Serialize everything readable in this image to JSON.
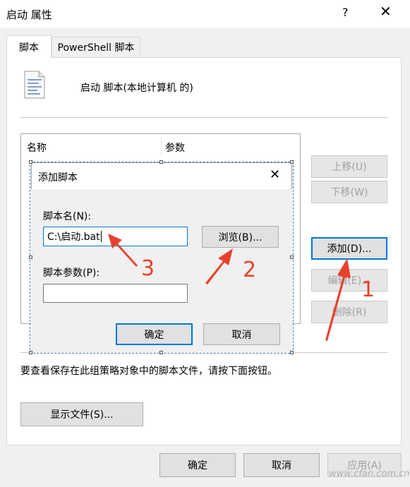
{
  "window": {
    "title": "启动 属性",
    "help_label": "?",
    "close_label": "✕"
  },
  "tabs": [
    {
      "label": "脚本"
    },
    {
      "label": "PowerShell 脚本"
    }
  ],
  "panel": {
    "heading": "启动 脚本(本地计算机 的)",
    "columns": [
      "名称",
      "参数"
    ],
    "buttons": {
      "up": "上移(U)",
      "down": "下移(W)",
      "add": "添加(D)...",
      "edit": "编辑(E)...",
      "remove": "删除(R)"
    },
    "note": "要查看保存在此组策略对象中的脚本文件，请按下面按钮。",
    "show_files": "显示文件(S)..."
  },
  "footer": {
    "ok": "确定",
    "cancel": "取消",
    "apply": "应用(A)"
  },
  "dialog": {
    "title": "添加脚本",
    "close_label": "✕",
    "script_name_label": "脚本名(N):",
    "script_name_value": "C:\\启动.bat",
    "browse": "浏览(B)...",
    "script_params_label": "脚本参数(P):",
    "script_params_value": "",
    "ok": "确定",
    "cancel": "取消"
  },
  "annotations": {
    "step1": "1",
    "step2": "2",
    "step3": "3",
    "color": "#e8412c"
  },
  "watermark": "www.cfan.com.cn"
}
